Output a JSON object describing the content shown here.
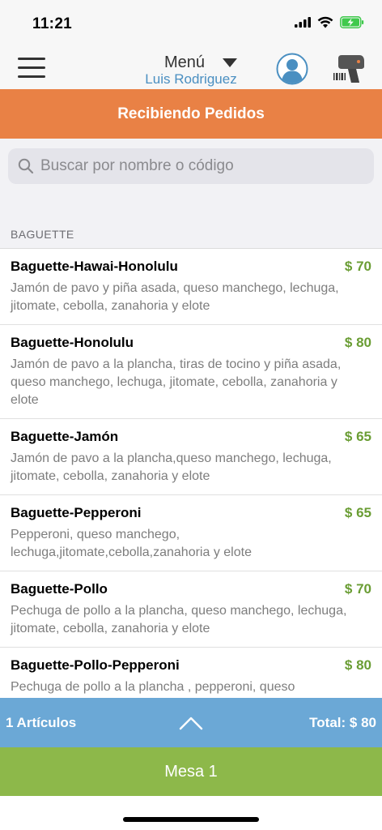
{
  "status_bar": {
    "time": "11:21",
    "icons": [
      "cellular-signal-icon",
      "wifi-icon",
      "battery-charging-icon"
    ],
    "battery_color": "#3fc94c"
  },
  "nav": {
    "title": "Menú",
    "subtitle": "Luis Rodriguez",
    "icons": [
      "hamburger-menu-icon",
      "caret-down-icon",
      "user-avatar-icon",
      "barcode-scanner-icon"
    ],
    "accent_color": "#4a8fc1"
  },
  "banner": {
    "label": "Recibiendo Pedidos",
    "color": "#e98145"
  },
  "search": {
    "placeholder": "Buscar por nombre o código",
    "value": "",
    "icon": "search-icon"
  },
  "section": {
    "label": "BAGUETTE"
  },
  "items": [
    {
      "name": "Baguette-Hawai-Honolulu",
      "price": "$ 70",
      "description": "Jamón de pavo y piña asada, queso manchego, lechuga, jitomate, cebolla, zanahoria y elote"
    },
    {
      "name": "Baguette-Honolulu",
      "price": "$ 80",
      "description": "Jamón de pavo a la plancha, tiras de tocino y piña asada, queso manchego, lechuga, jitomate, cebolla, zanahoria y elote"
    },
    {
      "name": "Baguette-Jamón",
      "price": "$ 65",
      "description": "Jamón de pavo a la plancha,queso manchego, lechuga, jitomate, cebolla, zanahoria y elote"
    },
    {
      "name": "Baguette-Pepperoni",
      "price": "$ 65",
      "description": "Pepperoni, queso manchego, lechuga,jitomate,cebolla,zanahoria y elote"
    },
    {
      "name": "Baguette-Pollo",
      "price": "$ 70",
      "description": "Pechuga de pollo a la plancha, queso manchego, lechuga, jitomate, cebolla, zanahoria y elote"
    },
    {
      "name": "Baguette-Pollo-Pepperoni",
      "price": "$ 80",
      "description": "Pechuga de pollo a la plancha , pepperoni, queso manchego, lechuga, jitomate, cebolla, zanahoria y elote"
    }
  ],
  "cart_bar": {
    "count_label": "1 Artículos",
    "total_label": "Total: $ 80",
    "icon": "chevron-up-icon",
    "color": "#6ba8d6"
  },
  "table_bar": {
    "label": "Mesa 1",
    "color": "#8db84a"
  },
  "colors": {
    "price": "#6a9d34",
    "description": "#7d7d7d"
  }
}
